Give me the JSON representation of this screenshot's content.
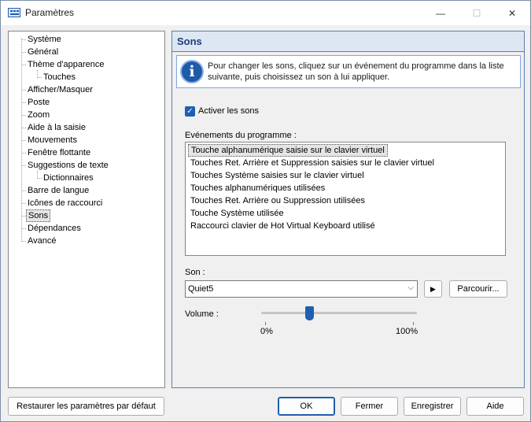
{
  "window": {
    "title": "Paramètres",
    "minimize_glyph": "—",
    "maximize_glyph": "☐",
    "close_glyph": "✕"
  },
  "tree": {
    "items": [
      {
        "label": "Système",
        "level": 0
      },
      {
        "label": "Général",
        "level": 0
      },
      {
        "label": "Thème d'apparence",
        "level": 0
      },
      {
        "label": "Touches",
        "level": 1
      },
      {
        "label": "Afficher/Masquer",
        "level": 0
      },
      {
        "label": "Poste",
        "level": 0
      },
      {
        "label": "Zoom",
        "level": 0
      },
      {
        "label": "Aide à la saisie",
        "level": 0
      },
      {
        "label": "Mouvements",
        "level": 0
      },
      {
        "label": "Fenêtre flottante",
        "level": 0
      },
      {
        "label": "Suggestions de texte",
        "level": 0
      },
      {
        "label": "Dictionnaires",
        "level": 1
      },
      {
        "label": "Barre de langue",
        "level": 0
      },
      {
        "label": "Icônes de raccourci",
        "level": 0
      },
      {
        "label": "Sons",
        "level": 0,
        "selected": true
      },
      {
        "label": "Dépendances",
        "level": 0
      },
      {
        "label": "Avancé",
        "level": 0
      }
    ]
  },
  "panel": {
    "title": "Sons",
    "info_icon": "i",
    "info_text": "Pour changer les sons, cliquez sur un événement du programme dans la liste suivante, puis choisissez un son à lui appliquer.",
    "enable_sounds_label": "Activer les sons",
    "enable_sounds_checked": true,
    "checkmark": "✓",
    "events_label": "Evénements du programme :",
    "events": [
      {
        "label": "Touche alphanumérique saisie sur le clavier virtuel",
        "selected": true
      },
      {
        "label": "Touches Ret. Arrière et Suppression saisies sur le clavier virtuel"
      },
      {
        "label": "Touches Système saisies sur le clavier virtuel"
      },
      {
        "label": "Touches alphanumériques utilisées"
      },
      {
        "label": "Touches Ret. Arrière ou Suppression utilisées"
      },
      {
        "label": "Touche Système utilisée"
      },
      {
        "label": "Raccourci clavier de Hot Virtual Keyboard utilisé"
      }
    ],
    "sound_label": "Son :",
    "sound_value": "Quiet5",
    "dropdown_arrow": "⌵",
    "play_glyph": "▶",
    "browse_label": "Parcourir...",
    "volume_label": "Volume :",
    "volume_fraction": 0.31,
    "volume_min_label": "0%",
    "volume_max_label": "100%"
  },
  "footer": {
    "restore_label": "Restaurer les paramètres par défaut",
    "ok_label": "OK",
    "close_label": "Fermer",
    "save_label": "Enregistrer",
    "help_label": "Aide"
  },
  "colors": {
    "accent": "#1f5fb0",
    "panel_header_bg": "#dde7f3",
    "panel_title": "#1d3f74"
  }
}
